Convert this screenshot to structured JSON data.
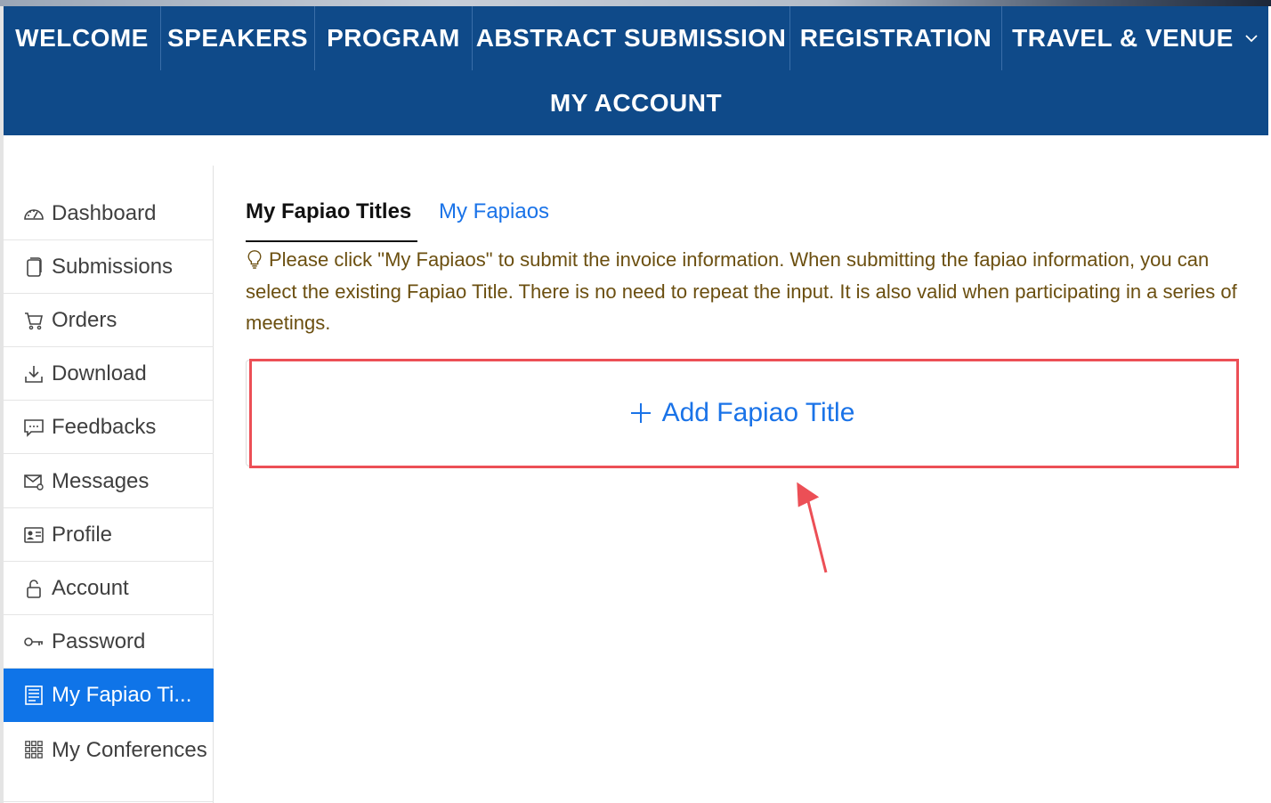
{
  "nav": {
    "row1": [
      {
        "label": "WELCOME",
        "width": 177
      },
      {
        "label": "SPEAKERS",
        "width": 173
      },
      {
        "label": "PROGRAM",
        "width": 177
      },
      {
        "label": "ABSTRACT SUBMISSION",
        "width": 357
      },
      {
        "label": "REGISTRATION",
        "width": 238
      },
      {
        "label": "TRAVEL & VENUE",
        "width": 299,
        "has_dropdown": true
      }
    ],
    "row2": [
      {
        "label": "MY ACCOUNT"
      }
    ]
  },
  "sidebar": {
    "items": [
      {
        "label": "Dashboard",
        "icon": "dashboard-icon"
      },
      {
        "label": "Submissions",
        "icon": "document-icon"
      },
      {
        "label": "Orders",
        "icon": "cart-icon"
      },
      {
        "label": "Download",
        "icon": "download-icon"
      },
      {
        "label": "Feedbacks",
        "icon": "feedback-icon"
      },
      {
        "label": "Messages",
        "icon": "mail-icon"
      },
      {
        "label": "Profile",
        "icon": "id-card-icon"
      },
      {
        "label": "Account",
        "icon": "lock-icon"
      },
      {
        "label": "Password",
        "icon": "key-icon"
      },
      {
        "label": "My Fapiao Ti...",
        "icon": "receipt-icon",
        "active": true
      },
      {
        "label": "My Conferences",
        "icon": "grid-icon"
      }
    ]
  },
  "main": {
    "tabs": [
      {
        "label": "My Fapiao Titles",
        "active": true
      },
      {
        "label": "My Fapiaos",
        "active": false
      }
    ],
    "tip": "Please click \"My Fapiaos\" to submit the invoice information. When submitting the fapiao information, you can select the existing Fapiao Title. There is no need to repeat the input. It is also valid when participating in a series of meetings.",
    "add_button_label": "Add Fapiao Title"
  },
  "colors": {
    "nav_bg": "#0f4a89",
    "active_bg": "#0f74e8",
    "link": "#1a73e8",
    "tip_text": "#6b4f10",
    "annotation": "#ec4f56"
  }
}
